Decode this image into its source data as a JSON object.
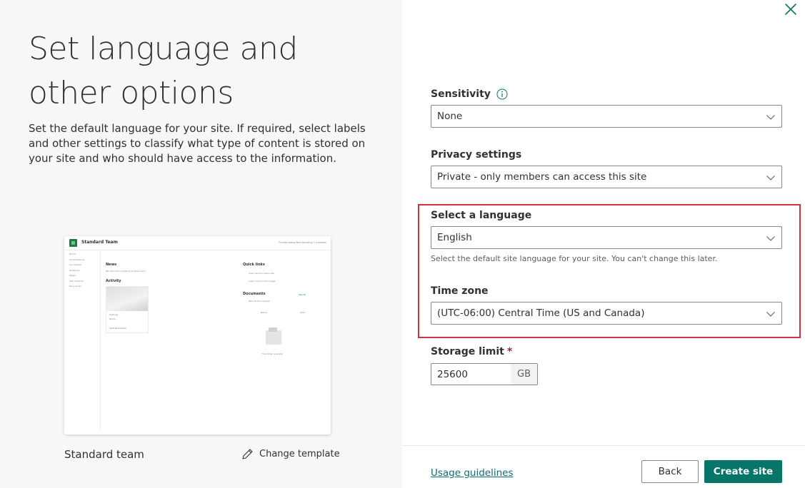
{
  "left": {
    "title": "Set language and other options",
    "description": "Set the default language for your site. If required, select labels and other settings to classify what type of content is stored on your site and who should have access to the information.",
    "preview": {
      "site_name": "Standard Team",
      "header_right": "Private group   Not following   1 member",
      "nav_items": [
        "Home",
        "Conversations",
        "Documents",
        "Notebook",
        "Pages",
        "Site contents",
        "Recycle bin"
      ],
      "news_title": "News",
      "news_text": "We didn't find anything to show here",
      "activity_title": "Activity",
      "card_title": "Settings",
      "card_sub": "Name",
      "card_footer": "Staff Newsletter",
      "quick_links_title": "Quick links",
      "quick_links": [
        "Learn about a team site",
        "Learn how to add a page"
      ],
      "documents_title": "Documents",
      "see_all": "See all",
      "doc_toolbar": "New      All Documents",
      "doc_column": "Name",
      "doc_column_right": "Modi",
      "empty_folder": "This folder is empty"
    },
    "template_name": "Standard team",
    "change_template": "Change template"
  },
  "form": {
    "sensitivity": {
      "label": "Sensitivity",
      "value": "None"
    },
    "privacy": {
      "label": "Privacy settings",
      "value": "Private - only members can access this site"
    },
    "language": {
      "label": "Select a language",
      "value": "English",
      "hint": "Select the default site language for your site. You can't change this later."
    },
    "timezone": {
      "label": "Time zone",
      "value": "(UTC-06:00) Central Time (US and Canada)"
    },
    "storage": {
      "label": "Storage limit",
      "required_mark": "*",
      "value": "25600",
      "unit": "GB"
    }
  },
  "footer": {
    "usage_link": "Usage guidelines",
    "back_label": "Back",
    "create_label": "Create site"
  },
  "colors": {
    "accent": "#077568",
    "highlight_border": "#d13438",
    "link": "#0f6c6f"
  }
}
